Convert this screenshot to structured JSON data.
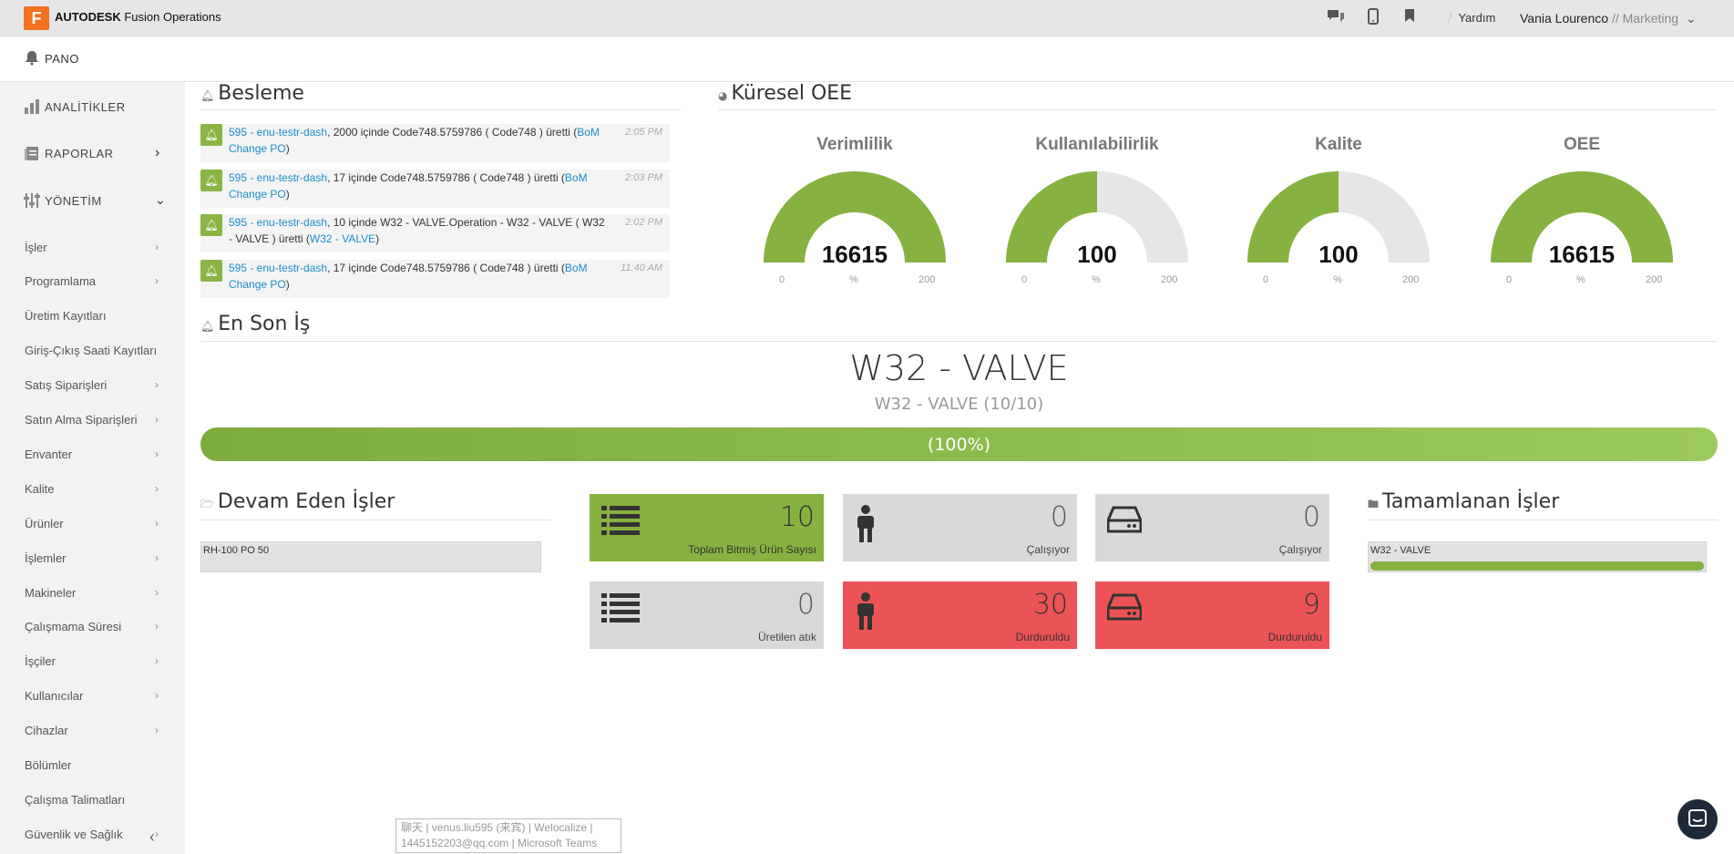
{
  "topbar": {
    "logo_letter": "F",
    "brand_bold": "AUTODESK",
    "brand_rest": "Fusion Operations",
    "help": "Yardım",
    "user": "Vania Lourenco",
    "role": "// Marketing"
  },
  "sidebar": {
    "pano": "PANO",
    "analytics": "ANALİTİKLER",
    "reports": "RAPORLAR",
    "management": "YÖNETİM",
    "items": [
      {
        "label": "İşler",
        "chevron": true
      },
      {
        "label": "Programlama",
        "chevron": true
      },
      {
        "label": "Üretim Kayıtları",
        "chevron": false
      },
      {
        "label": "Giriş-Çıkış Saati Kayıtları",
        "chevron": false
      },
      {
        "label": "Satış Siparişleri",
        "chevron": true
      },
      {
        "label": "Satın Alma Siparişleri",
        "chevron": true
      },
      {
        "label": "Envanter",
        "chevron": true
      },
      {
        "label": "Kalite",
        "chevron": true
      },
      {
        "label": "Ürünler",
        "chevron": true
      },
      {
        "label": "İşlemler",
        "chevron": true
      },
      {
        "label": "Makineler",
        "chevron": true
      },
      {
        "label": "Çalışmama Süresi",
        "chevron": true
      },
      {
        "label": "İşçiler",
        "chevron": true
      },
      {
        "label": "Kullanıcılar",
        "chevron": true
      },
      {
        "label": "Cihazlar",
        "chevron": true
      },
      {
        "label": "Bölümler",
        "chevron": false
      },
      {
        "label": "Çalışma Talimatları",
        "chevron": false
      },
      {
        "label": "Güvenlik ve Sağlık",
        "chevron": true
      }
    ]
  },
  "feed": {
    "title": "Besleme",
    "items": [
      {
        "link": "595 - enu-testr-dash",
        "text": ", 2000 içinde Code748.5759786 ( Code748 ) üretti (",
        "link2": "BoM Change PO",
        "tail": ")",
        "time": "2:05 PM"
      },
      {
        "link": "595 - enu-testr-dash",
        "text": ", 17 içinde Code748.5759786 ( Code748 ) üretti (",
        "link2": "BoM Change PO",
        "tail": ")",
        "time": "2:03 PM"
      },
      {
        "link": "595 - enu-testr-dash",
        "text": ", 10 içinde W32 - VALVE.Operation - W32 - VALVE ( W32 - VALVE ) üretti (",
        "link2": "W32 - VALVE",
        "tail": ")",
        "time": "2:02 PM"
      },
      {
        "link": "595 - enu-testr-dash",
        "text": ", 17 içinde Code748.5759786 ( Code748 ) üretti (",
        "link2": "BoM Change PO",
        "tail": ")",
        "time": "11:40 AM"
      }
    ]
  },
  "oee": {
    "title": "Küresel OEE",
    "gauges": [
      {
        "title": "Verimlilik",
        "value": "16615",
        "fraction": 1.0,
        "min": "0",
        "max": "200",
        "unit": "%"
      },
      {
        "title": "Kullanılabilirlik",
        "value": "100",
        "fraction": 0.5,
        "min": "0",
        "max": "200",
        "unit": "%"
      },
      {
        "title": "Kalite",
        "value": "100",
        "fraction": 0.5,
        "min": "0",
        "max": "200",
        "unit": "%"
      },
      {
        "title": "OEE",
        "value": "16615",
        "fraction": 1.0,
        "min": "0",
        "max": "200",
        "unit": "%"
      }
    ],
    "colors": {
      "fill": "#86b241",
      "track": "#e6e6e6"
    }
  },
  "last_job": {
    "title": "En Son İş",
    "name": "W32 - VALVE",
    "sub": "W32 - VALVE (10/10)",
    "progress_pct": 100,
    "progress_label": "(100%)"
  },
  "ongoing": {
    "title": "Devam Eden İşler",
    "rows": [
      "RH-100 PO 50"
    ]
  },
  "tiles": [
    {
      "value": "10",
      "label": "Toplam Bitmiş Ürün Sayısı",
      "icon": "list-icon",
      "color": "green"
    },
    {
      "value": "0",
      "label": "Çalışıyor",
      "icon": "person-icon",
      "color": "gray"
    },
    {
      "value": "0",
      "label": "Çalışıyor",
      "icon": "drive-icon",
      "color": "gray"
    },
    {
      "value": "0",
      "label": "Üretilen atık",
      "icon": "list-icon",
      "color": "gray"
    },
    {
      "value": "30",
      "label": "Durduruldu",
      "icon": "person-icon",
      "color": "red"
    },
    {
      "value": "9",
      "label": "Durduruldu",
      "icon": "drive-icon",
      "color": "red"
    }
  ],
  "completed": {
    "title": "Tamamlanan İşler",
    "rows": [
      {
        "label": "W32 - VALVE",
        "progress": 1.0
      }
    ]
  },
  "tooltip": {
    "line1": "聊天 | venus.liu595 (来宾) | Welocalize |",
    "line2": "1445152203@qq.com | Microsoft Teams"
  }
}
